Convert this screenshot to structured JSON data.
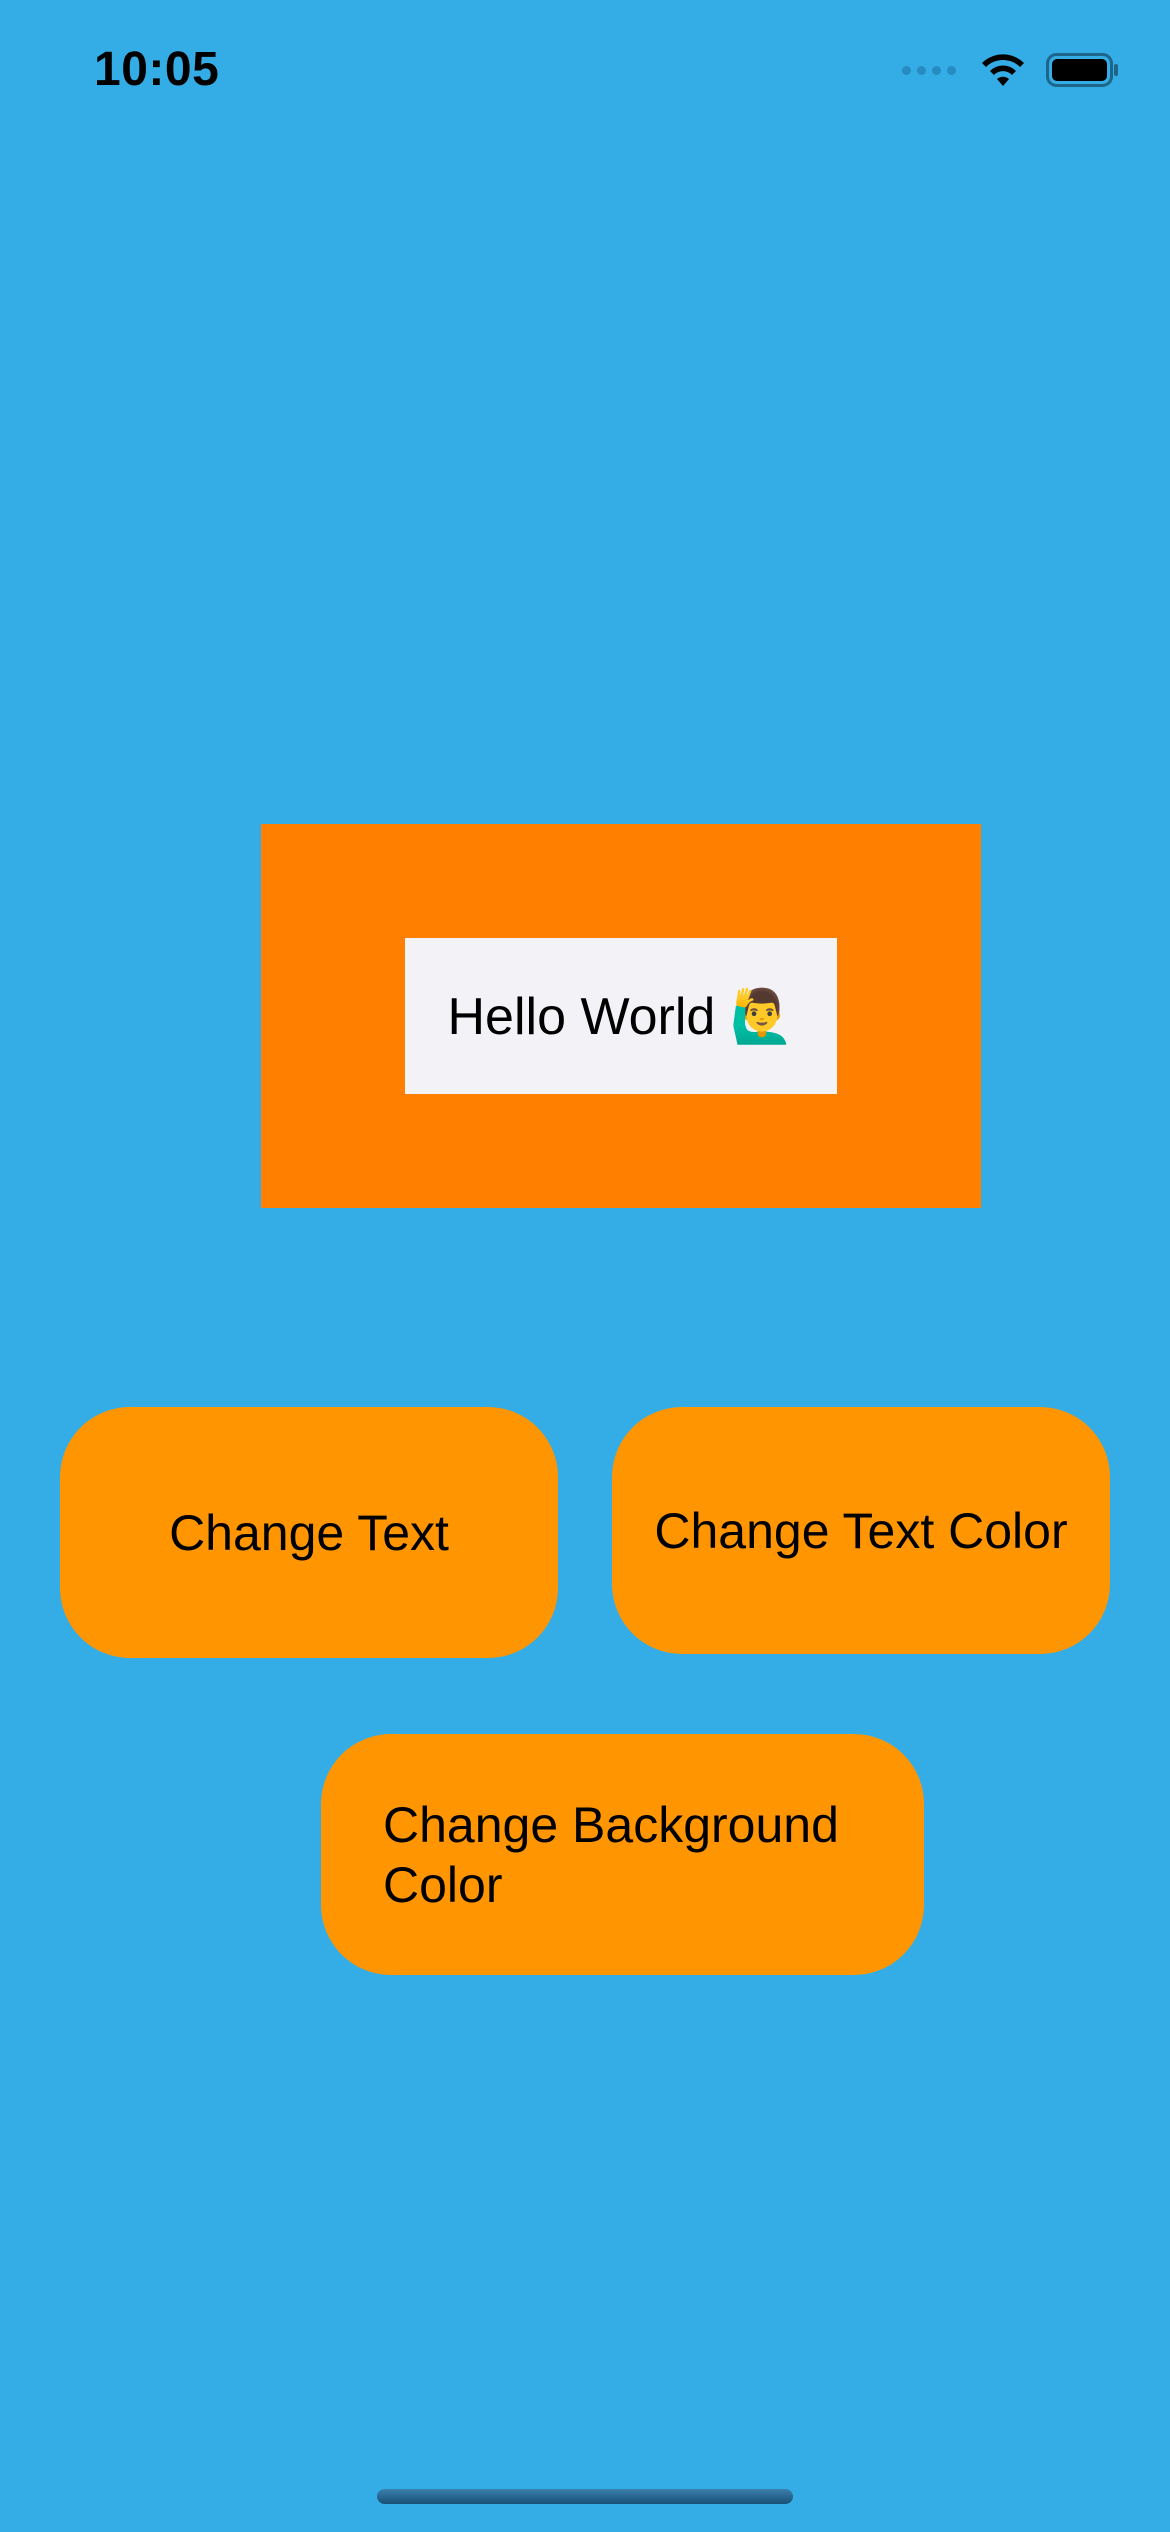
{
  "colors": {
    "background": "#34ade6",
    "outer_box": "#ff7f00",
    "label_background": "#f2f2f7",
    "button": "#ff9500",
    "text": "#000000"
  },
  "status_bar": {
    "time": "10:05",
    "icons": [
      "cellular-dots-icon",
      "wifi-icon",
      "battery-icon"
    ]
  },
  "hello_label": {
    "text": "Hello World 🙋‍♂️"
  },
  "buttons": {
    "change_text": "Change Text",
    "change_text_color": "Change Text Color",
    "change_background_color": "Change Background Color"
  }
}
